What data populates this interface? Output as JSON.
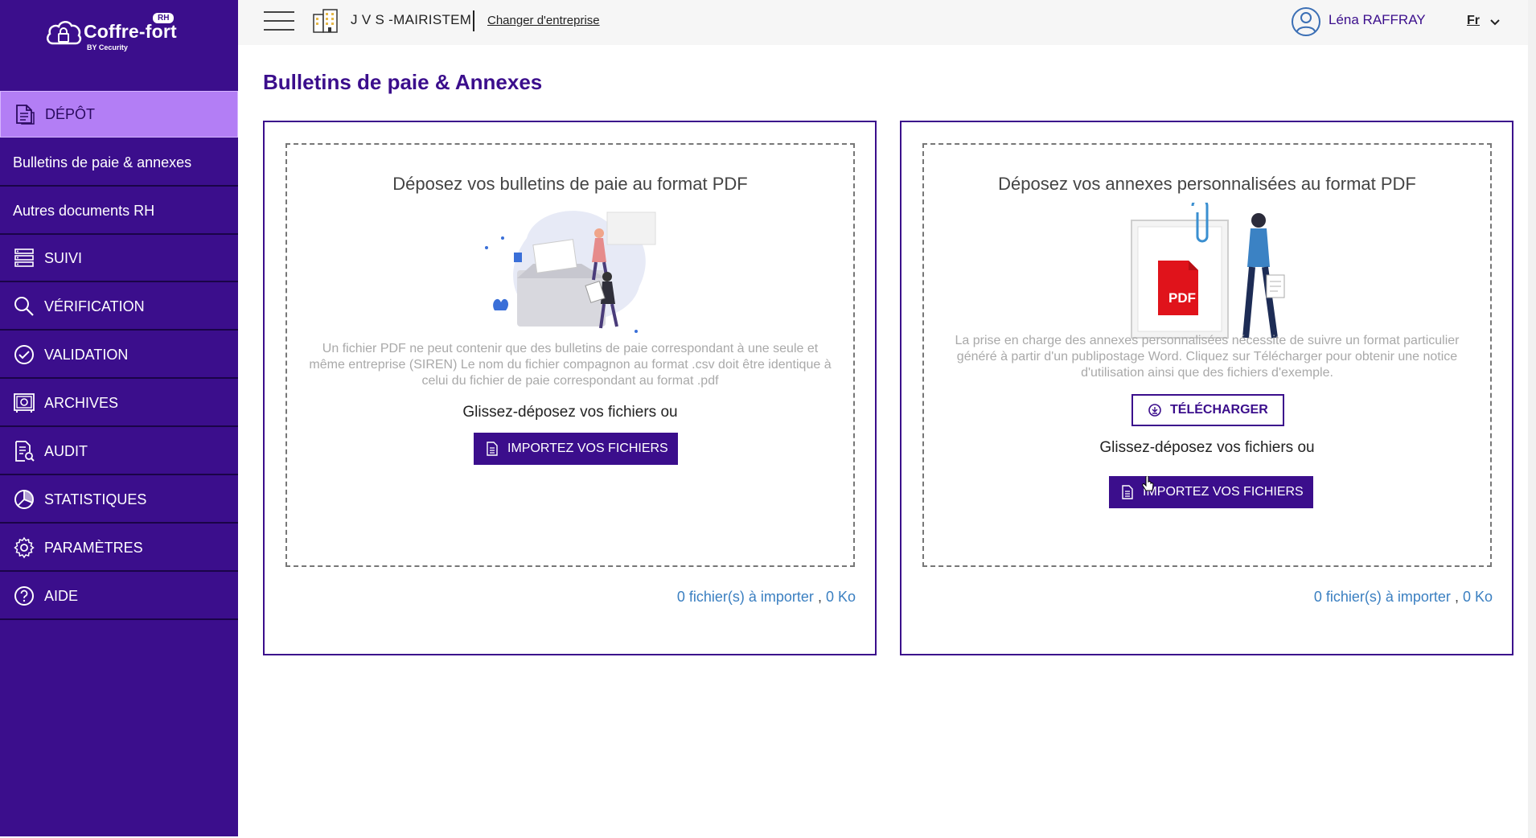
{
  "app": {
    "logo_text": "Coffre-fort",
    "logo_badge": "RH",
    "logo_sub": "BY Cecurity"
  },
  "sidebar": {
    "items": [
      {
        "label": "DÉPÔT",
        "icon": "document-stack-icon",
        "active": true
      },
      {
        "label": "Bulletins de paie & annexes",
        "sub": true
      },
      {
        "label": "Autres documents RH",
        "sub": true
      },
      {
        "label": "SUIVI",
        "icon": "list-icon"
      },
      {
        "label": "VÉRIFICATION",
        "icon": "search-icon"
      },
      {
        "label": "VALIDATION",
        "icon": "check-circle-icon"
      },
      {
        "label": "ARCHIVES",
        "icon": "vault-icon"
      },
      {
        "label": "AUDIT",
        "icon": "audit-document-icon"
      },
      {
        "label": "STATISTIQUES",
        "icon": "pie-chart-icon"
      },
      {
        "label": "PARAMÈTRES",
        "icon": "gear-icon"
      },
      {
        "label": "AIDE",
        "icon": "help-circle-icon"
      }
    ]
  },
  "topbar": {
    "company": "J V S -MAIRISTEM",
    "change_company": "Changer d'entreprise",
    "user": "Léna RAFFRAY",
    "language": "Fr"
  },
  "page": {
    "title": "Bulletins de paie & Annexes"
  },
  "left_card": {
    "title": "Déposez vos bulletins de paie au format PDF",
    "description": "Un fichier PDF ne peut contenir que des bulletins de paie correspondant à une seule et même entreprise (SIREN) Le nom du fichier compagnon au format .csv doit être identique à celui du fichier de paie correspondant au format .pdf",
    "drag_text": "Glissez-déposez vos fichiers ou",
    "import_button": "IMPORTEZ VOS FICHIERS",
    "count_files": "0 fichier(s) à importer",
    "count_sep": ",",
    "count_size": "0 Ko"
  },
  "right_card": {
    "title": "Déposez vos annexes personnalisées au format PDF",
    "description": "La prise en charge des annexes personnalisées nécessite de suivre un format particulier généré à partir d'un publipostage Word. Cliquez sur Télécharger pour obtenir une notice d'utilisation ainsi que des fichiers d'exemple.",
    "download_button": "TÉLÉCHARGER",
    "drag_text": "Glissez-déposez vos fichiers ou",
    "import_button": "IMPORTEZ VOS FICHIERS",
    "pdf_label": "PDF",
    "count_files": "0 fichier(s) à importer",
    "count_sep": ",",
    "count_size": "0 Ko"
  },
  "colors": {
    "brand": "#3b0e8c",
    "active_nav": "#b37ef5",
    "link_blue": "#3a7fc1",
    "pdf_red": "#e0131b"
  }
}
